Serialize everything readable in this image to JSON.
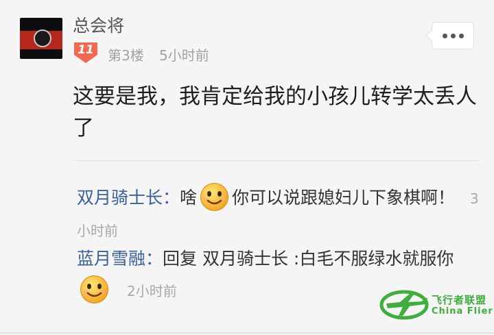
{
  "post": {
    "username": "总会将",
    "level": "11",
    "floor": "第3楼",
    "time": "5小时前",
    "content": "这要是我，我肯定给我的小孩儿转学太丢人了"
  },
  "replies": [
    {
      "author": "双月骑士长：",
      "text_before": "啥",
      "emoji": "smile-emoji",
      "text_after": "你可以说跟媳妇儿下象棋啊！",
      "time": "3小时前"
    },
    {
      "author": "蓝月雪融：",
      "text_before": "回复 双月骑士长 :白毛不服绿水就服你",
      "emoji": "smile-emoji",
      "text_after": "",
      "time": "2小时前"
    }
  ],
  "watermark": {
    "name_cn": "飞行者联盟",
    "name_en": "China Flier"
  },
  "colors": {
    "author_link": "#3a5f9a",
    "level_badge": "#f06a4f",
    "watermark": "#3fae3c"
  }
}
